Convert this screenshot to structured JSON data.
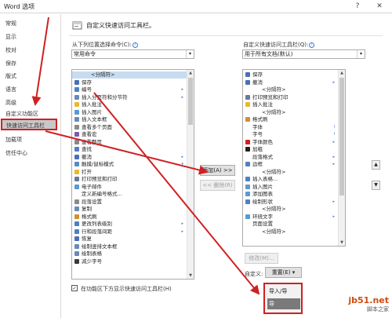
{
  "window": {
    "title": "Word 选项",
    "help": "?",
    "close": "✕"
  },
  "sidebar": {
    "items": [
      {
        "label": "常规",
        "active": false
      },
      {
        "label": "显示",
        "active": false
      },
      {
        "label": "校对",
        "active": false
      },
      {
        "label": "保存",
        "active": false
      },
      {
        "label": "版式",
        "active": false
      },
      {
        "label": "语言",
        "active": false
      },
      {
        "label": "高级",
        "active": false
      },
      {
        "label": "自定义功能区",
        "active": false
      },
      {
        "label": "快速访问工具栏",
        "active": true
      },
      {
        "label": "加载项",
        "active": false
      },
      {
        "label": "信任中心",
        "active": false
      }
    ]
  },
  "main": {
    "section_title": "自定义快速访问工具栏。",
    "left": {
      "choose_label": "从下列位置选择命令(C):",
      "choose_value": "常用命令",
      "commands": [
        {
          "label": "<分隔符>",
          "icon": "separator",
          "color": "",
          "selected": true,
          "sub": ""
        },
        {
          "label": "保存",
          "icon": "save",
          "color": "#4a6fb5",
          "sub": ""
        },
        {
          "label": "编号",
          "icon": "numbering",
          "color": "#5080c0",
          "sub": "▸"
        },
        {
          "label": "插入分页符和分节符",
          "icon": "page-break",
          "color": "#6a8ab8",
          "sub": "▸"
        },
        {
          "label": "插入批注",
          "icon": "comment",
          "color": "#e8b830",
          "sub": ""
        },
        {
          "label": "插入图片",
          "icon": "picture",
          "color": "#5a9ad0",
          "sub": ""
        },
        {
          "label": "插入文本框",
          "icon": "textbox",
          "color": "#6a8ab8",
          "sub": ""
        },
        {
          "label": "查看多个页面",
          "icon": "multi-page",
          "color": "#8a8a8a",
          "sub": ""
        },
        {
          "label": "查看宏",
          "icon": "macro",
          "color": "#7a5aa8",
          "sub": ""
        },
        {
          "label": "查看整页",
          "icon": "one-page",
          "color": "#8a8a8a",
          "sub": ""
        },
        {
          "label": "查找",
          "icon": "find",
          "color": "#5080c0",
          "sub": ""
        },
        {
          "label": "撤消",
          "icon": "undo",
          "color": "#4a6fb5",
          "sub": "▸"
        },
        {
          "label": "触摸/鼠标模式",
          "icon": "touch-mode",
          "color": "#5a8ac8",
          "sub": "▾"
        },
        {
          "label": "打开",
          "icon": "open",
          "color": "#e8b830",
          "sub": ""
        },
        {
          "label": "打印预览和打印",
          "icon": "print-preview",
          "color": "#6a7a9a",
          "sub": ""
        },
        {
          "label": "电子邮件",
          "icon": "email",
          "color": "#5a9ad0",
          "sub": ""
        },
        {
          "label": "定义新编号格式...",
          "icon": "",
          "color": "",
          "sub": ""
        },
        {
          "label": "段落设置",
          "icon": "paragraph",
          "color": "#8a8a8a",
          "sub": ""
        },
        {
          "label": "复制",
          "icon": "copy",
          "color": "#6a8ab8",
          "sub": ""
        },
        {
          "label": "格式刷",
          "icon": "format-painter",
          "color": "#d09030",
          "sub": ""
        },
        {
          "label": "更改列表级别",
          "icon": "list-level",
          "color": "#5080c0",
          "sub": "▸"
        },
        {
          "label": "行和段落间距",
          "icon": "line-spacing",
          "color": "#5080c0",
          "sub": "▸"
        },
        {
          "label": "恢复",
          "icon": "redo",
          "color": "#4a6fb5",
          "sub": ""
        },
        {
          "label": "绘制竖排文本框",
          "icon": "vertical-textbox",
          "color": "#6a8ab8",
          "sub": ""
        },
        {
          "label": "绘制表格",
          "icon": "draw-table",
          "color": "#6a8ab8",
          "sub": ""
        },
        {
          "label": "减少字号",
          "icon": "shrink-font",
          "color": "#3a3a3a",
          "sub": ""
        }
      ],
      "show_below_label": "在功能区下方显示快速访问工具栏(H)",
      "show_below_checked": true
    },
    "middle": {
      "add_label": "添加(A) >>",
      "remove_label": "<< 删除(R)"
    },
    "right": {
      "customize_label": "自定义快速访问工具栏(Q):",
      "customize_value": "用于所有文档(默认)",
      "commands": [
        {
          "label": "保存",
          "icon": "save",
          "color": "#4a6fb5",
          "indent": false,
          "sub": "",
          "selected": false
        },
        {
          "label": "撤消",
          "icon": "undo",
          "color": "#4a6fb5",
          "indent": false,
          "sub": "▸",
          "selected": false
        },
        {
          "label": "<分隔符>",
          "icon": "",
          "color": "",
          "indent": true,
          "sub": "",
          "selected": false
        },
        {
          "label": "打印预览和打印",
          "icon": "print-preview",
          "color": "#6a7a9a",
          "indent": false,
          "sub": "",
          "selected": false
        },
        {
          "label": "插入批注",
          "icon": "comment",
          "color": "#e8b830",
          "indent": false,
          "sub": "",
          "selected": false
        },
        {
          "label": "<分隔符>",
          "icon": "",
          "color": "",
          "indent": true,
          "sub": "",
          "selected": false
        },
        {
          "label": "格式刷",
          "icon": "format-painter",
          "color": "#d09030",
          "indent": false,
          "sub": "",
          "selected": false
        },
        {
          "label": "字体",
          "icon": "",
          "color": "",
          "indent": false,
          "sub": "I",
          "selected": false
        },
        {
          "label": "字号",
          "icon": "",
          "color": "",
          "indent": false,
          "sub": "I",
          "selected": false
        },
        {
          "label": "字体颜色",
          "icon": "font-color",
          "color": "#d02020",
          "indent": false,
          "sub": "▸",
          "selected": false
        },
        {
          "label": "加粗",
          "icon": "bold",
          "color": "#222222",
          "indent": false,
          "sub": "",
          "selected": false
        },
        {
          "label": "段落格式",
          "icon": "",
          "color": "",
          "indent": false,
          "sub": "▸",
          "selected": false
        },
        {
          "label": "边框",
          "icon": "borders",
          "color": "#5080c0",
          "indent": false,
          "sub": "▸",
          "selected": false
        },
        {
          "label": "<分隔符>",
          "icon": "",
          "color": "",
          "indent": true,
          "sub": "",
          "selected": false
        },
        {
          "label": "插入表格...",
          "icon": "table",
          "color": "#5080c0",
          "indent": false,
          "sub": "",
          "selected": false
        },
        {
          "label": "插入图片",
          "icon": "picture",
          "color": "#5a9ad0",
          "indent": false,
          "sub": "",
          "selected": false
        },
        {
          "label": "添加图表",
          "icon": "chart",
          "color": "#5a9ad0",
          "indent": false,
          "sub": "",
          "selected": false
        },
        {
          "label": "绘制形状",
          "icon": "shapes",
          "color": "#5080c0",
          "indent": false,
          "sub": "▸",
          "selected": false
        },
        {
          "label": "<分隔符>",
          "icon": "",
          "color": "",
          "indent": true,
          "sub": "",
          "selected": false
        },
        {
          "label": "环绕文字",
          "icon": "wrap-text",
          "color": "#5a9ad0",
          "indent": false,
          "sub": "▸",
          "selected": false
        },
        {
          "label": "页面设置",
          "icon": "",
          "color": "",
          "indent": false,
          "sub": "",
          "selected": false
        },
        {
          "label": "<分隔符>",
          "icon": "",
          "color": "",
          "indent": true,
          "sub": "",
          "selected": false
        }
      ],
      "modify_label": "修改(M)...",
      "customizations_label": "自定义:",
      "reset_label": "重置(E) ▾",
      "import_export_label": "导入/导"
    },
    "popup": {
      "items": [
        {
          "label": "导入/导"
        },
        {
          "label": "导"
        }
      ]
    }
  },
  "watermark": {
    "line1": "jb51.net",
    "line2": "脚本之家"
  },
  "colors": {
    "accent_red": "#d02020",
    "selection": "#c7dcf2",
    "sidebar_active": "#c8c8c8"
  }
}
